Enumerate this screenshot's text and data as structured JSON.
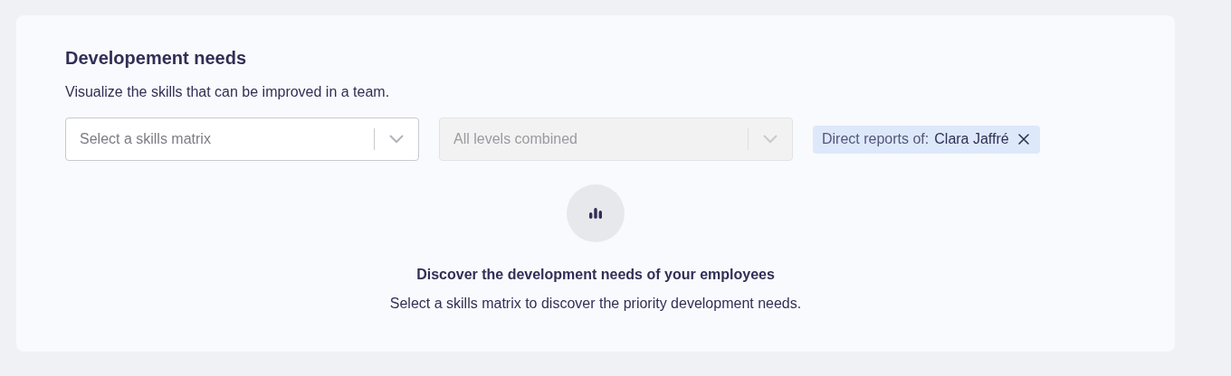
{
  "section": {
    "title": "Developement needs",
    "subtitle": "Visualize the skills that can be improved in a team."
  },
  "filters": [
    {
      "placeholder": "Select a skills matrix",
      "disabled": false
    },
    {
      "placeholder": "All levels combined",
      "disabled": true
    }
  ],
  "chips": [
    {
      "label": "Direct reports of:",
      "value": "Clara Jaffré"
    }
  ],
  "empty_state": {
    "title": "Discover the development needs of your employees",
    "message": "Select a skills matrix to discover the priority development needs."
  }
}
